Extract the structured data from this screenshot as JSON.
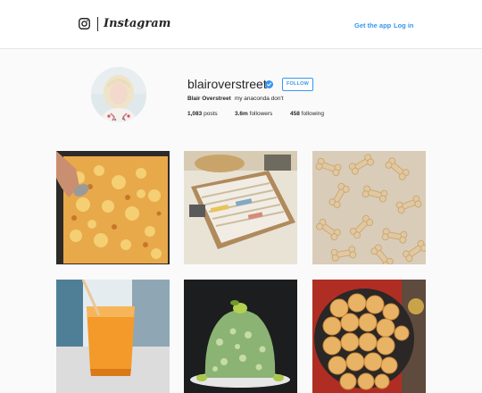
{
  "header": {
    "wordmark": "Instagram",
    "get_app_label": "Get the app",
    "login_label": "Log in",
    "link_color": "#3897f0"
  },
  "profile": {
    "username": "blairoverstreet",
    "verified": true,
    "follow_label": "FOLLOW",
    "display_name": "Blair Overstreet",
    "bio": "my anaconda don't",
    "stats": {
      "posts_count": "1,083",
      "posts_label": "posts",
      "followers_count": "3.6m",
      "followers_label": "followers",
      "following_count": "458",
      "following_label": "following"
    }
  },
  "posts": [
    {
      "subject": "baked mac and cheese"
    },
    {
      "subject": "recipe card box"
    },
    {
      "subject": "bone-shaped dog treats"
    },
    {
      "subject": "orange drink in glass"
    },
    {
      "subject": "green frosted bundt cake"
    },
    {
      "subject": "pull-apart rolls in skillet"
    }
  ]
}
